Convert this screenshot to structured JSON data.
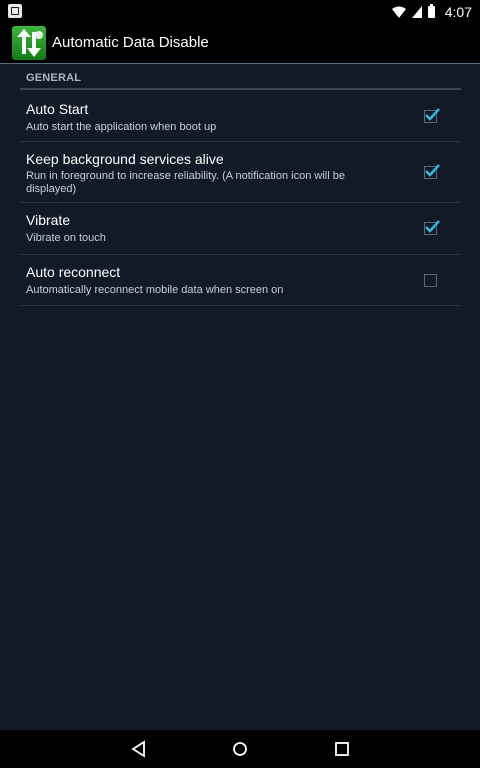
{
  "status_bar": {
    "time": "4:07",
    "icons": [
      "notification-icon",
      "wifi-icon",
      "signal-icon",
      "battery-icon"
    ]
  },
  "action_bar": {
    "title": "Automatic Data Disable",
    "icon": "app-icon"
  },
  "section": {
    "header": "GENERAL"
  },
  "preferences": [
    {
      "title": "Auto Start",
      "summary": "Auto start the application when boot up",
      "checked": true
    },
    {
      "title": "Keep background services alive",
      "summary": "Run in foreground to increase reliability. (A notification icon will be displayed)",
      "checked": true
    },
    {
      "title": "Vibrate",
      "summary": "Vibrate on touch",
      "checked": true
    },
    {
      "title": "Auto reconnect",
      "summary": "Automatically reconnect mobile data when screen on",
      "checked": false
    }
  ],
  "nav_bar": {
    "buttons": [
      "back-icon",
      "home-icon",
      "recents-icon"
    ]
  },
  "colors": {
    "background": "#111a26",
    "accent": "#33b5e5",
    "divider": "#2a3440"
  }
}
